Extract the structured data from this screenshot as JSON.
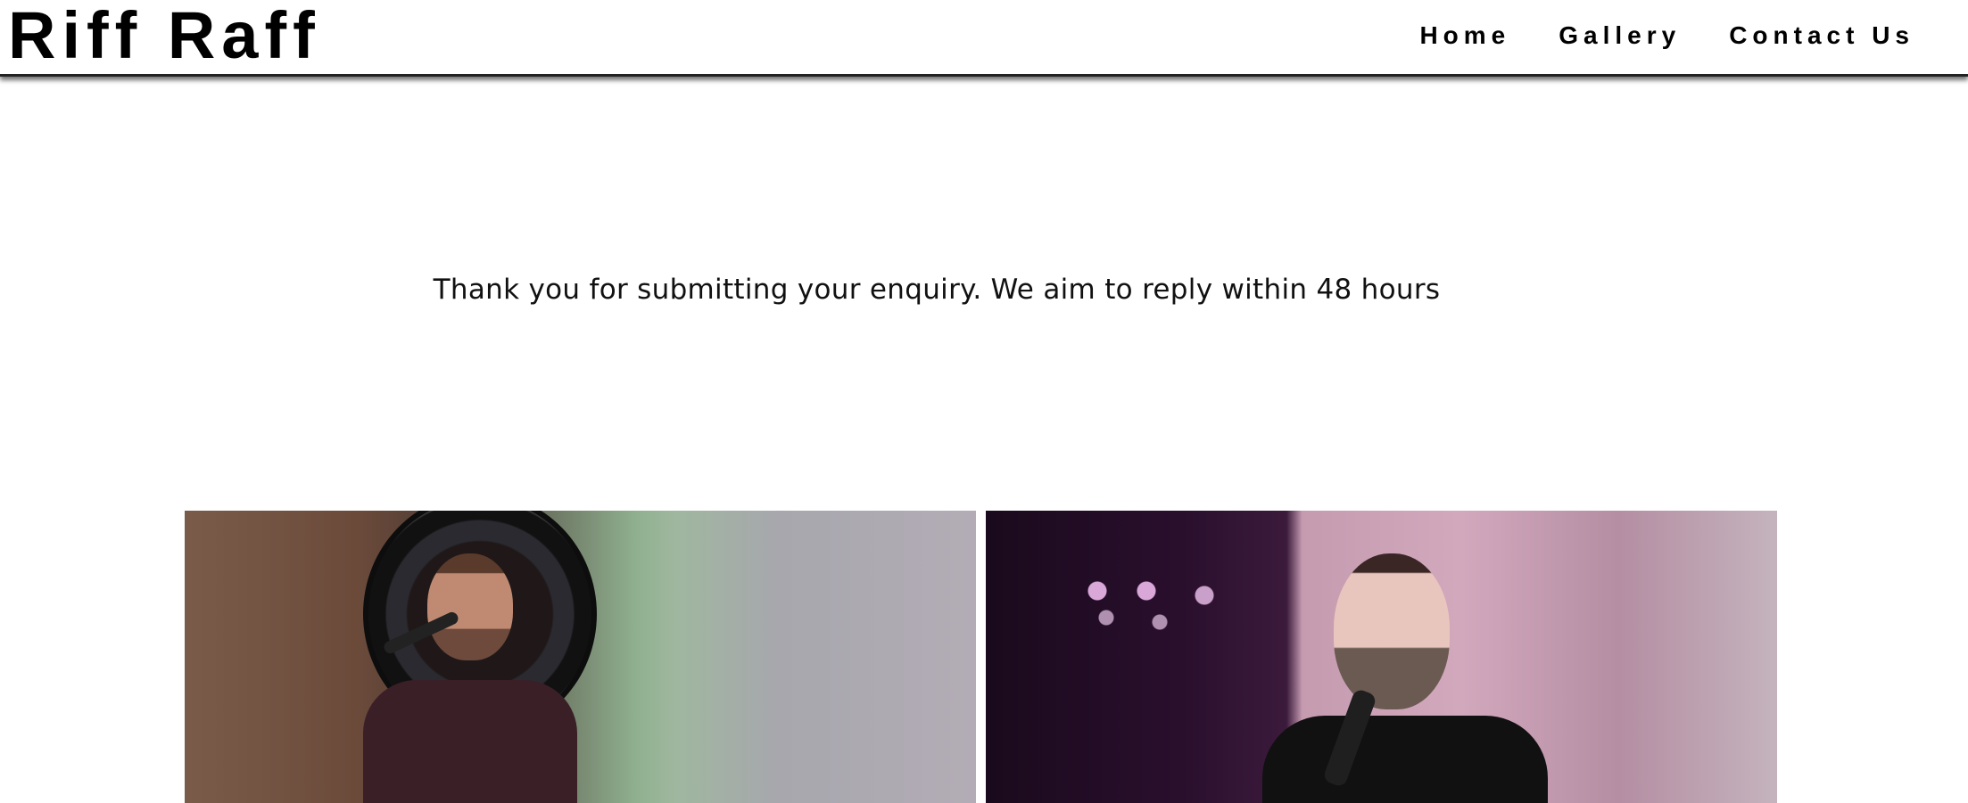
{
  "header": {
    "logo": "Riff Raff",
    "nav": [
      {
        "label": "Home"
      },
      {
        "label": "Gallery"
      },
      {
        "label": "Contact Us"
      }
    ]
  },
  "main": {
    "message": "Thank you for submitting your enquiry. We aim to reply within 48 hours"
  },
  "gallery": {
    "images": [
      {
        "name": "singer-at-microphone-photo"
      },
      {
        "name": "vocalist-with-microphone-photo"
      }
    ]
  }
}
